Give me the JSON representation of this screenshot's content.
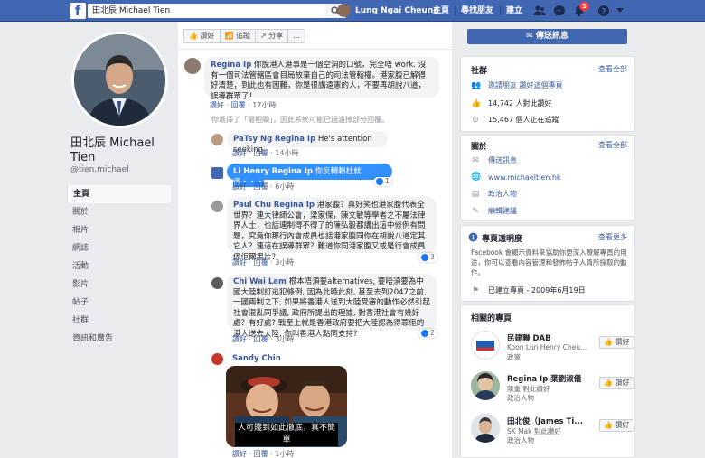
{
  "topbar": {
    "search_value": "田北辰 Michael Tien",
    "user_name": "Lung Ngai Cheung",
    "links": [
      "主頁",
      "尋找朋友",
      "建立"
    ],
    "notifications": "5"
  },
  "profile": {
    "name": "田北辰 Michael Tien",
    "handle": "@tien.michael"
  },
  "nav": [
    "主頁",
    "關於",
    "相片",
    "網誌",
    "活動",
    "影片",
    "帖子",
    "社群",
    "資訊和廣告"
  ],
  "actionbar": [
    "讚好",
    "追蹤",
    "分享",
    "..."
  ],
  "comments": [
    {
      "user": "Regina Ip",
      "text": "你說港人港事是一個空洞的口號，完全唔 work. 沒有一個司法管轄區會目局放棄自己的司法管轄權。港家腹已解得好清楚，到此也有困難，你是很講遠憲的人，不要再胡說八道，誤導群眾了！",
      "actions": [
        "讚好",
        "回覆",
        "17小時"
      ]
    },
    {
      "notice": "你選擇了「最相關」，因此系統可能已過濾掉部分回覆。"
    },
    {
      "user": "PaTsy Ng",
      "mention": "Regina Ip",
      "text": "He's attention seeking",
      "actions": [
        "讚好",
        "回覆",
        "14小時"
      ]
    },
    {
      "user": "Li Henry",
      "mention": "Regina Ip",
      "text": "你反轉賴杜就係・・・",
      "actions": [
        "讚好",
        "回覆",
        "6小時"
      ],
      "reactions": "1"
    },
    {
      "user": "Paul Chu",
      "mention": "Regina Ip",
      "text": "港家腹？真好笑也港家腹代表全世界？連大律師公會，梁家傑，陳文敏等學者之不屬法律界人士，也話連制得不得了的陳弘毅都講出這中修例有問題，究竟你那行內會成員也話港家腹同你在胡說八道定其它人？連這在誤導群眾？難道你同港家腹又或是行會成員係佢爾黑片？",
      "actions": [
        "讚好",
        "回覆",
        "3小時"
      ],
      "reactions": "3"
    },
    {
      "user": "Chi Wai Lam",
      "text": "根本唔須要alternatives, 要唔須要為中國大陸制訂逃犯條例, 因為此時此刻, 甚至去到2047之前, 一國兩制之下, 如果將香港人送到大陸受審的動作必然引起社會混亂同爭議, 政府所提出的理據, 對香港社會有幾好處？有好處? 戰至上就是香港政府要把大陸認為得罪佢的港人送去大陸, 你叫香港人點同支持?",
      "actions": [
        "讚好",
        "回覆",
        "3小時"
      ],
      "reactions": "2"
    },
    {
      "user": "Sandy Chin",
      "meme_caption": "人可賤到如此徹底，真不簡單",
      "actions": [
        "讚好",
        "回覆",
        "1小時"
      ]
    }
  ],
  "right": {
    "message_button": "傳送訊息",
    "community": {
      "title": "社群",
      "see_all": "查看全部",
      "rows": [
        "邀請朋友 讚好這個專頁",
        "14,742 人對此讚好",
        "15,467 個人正在追蹤"
      ]
    },
    "about": {
      "title": "關於",
      "see_all": "查看全部",
      "rows": [
        "傳送訊息",
        "www.michaeltien.hk",
        "政治人物",
        "編輯建議"
      ]
    },
    "transparency": {
      "title": "專頁透明度",
      "see_more": "查看更多",
      "text": "Facebook 會顯示資料來協助你更深入瞭解專頁的用途，你可以查看內容管理和發佈帖子人員所採取的動作。",
      "created": "已建立專頁 - 2009年6月19日"
    },
    "related": {
      "title": "相關的專頁",
      "items": [
        {
          "name": "民建聯 DAB",
          "sub": "Koon Lun Henry Cheu...",
          "sub2": "政黨",
          "button": "讚好"
        },
        {
          "name": "Regina Ip 葉劉淑儀",
          "sub": "陳重 對此讚好",
          "sub2": "政治人物",
          "button": "讚好"
        },
        {
          "name": "田北俊（James Ti...",
          "sub": "SK Mak 對此讚好",
          "sub2": "政治人物",
          "button": "讚好"
        }
      ]
    }
  }
}
